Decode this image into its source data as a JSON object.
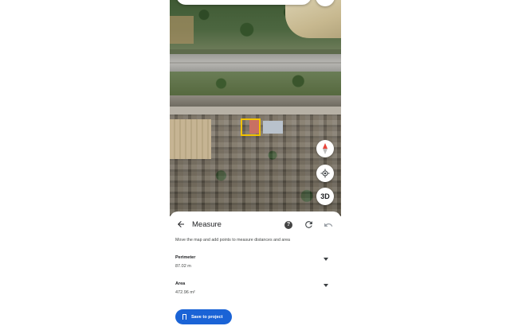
{
  "map": {
    "controls": {
      "compass_icon": "compass-icon",
      "locate_icon": "my-location-icon",
      "three_d_label": "3D"
    }
  },
  "measure": {
    "title": "Measure",
    "back_icon": "arrow-back-icon",
    "help_icon": "help-icon",
    "refresh_icon": "refresh-icon",
    "undo_icon": "undo-icon",
    "instructions": "Move the map and add points to measure distances and area",
    "perimeter": {
      "label": "Perimeter",
      "value": "87.02 m"
    },
    "area": {
      "label": "Area",
      "value": "472.96 m²"
    },
    "save_label": "Save to project"
  },
  "colors": {
    "accent": "#1a63d6",
    "selection": "#f2c200"
  }
}
